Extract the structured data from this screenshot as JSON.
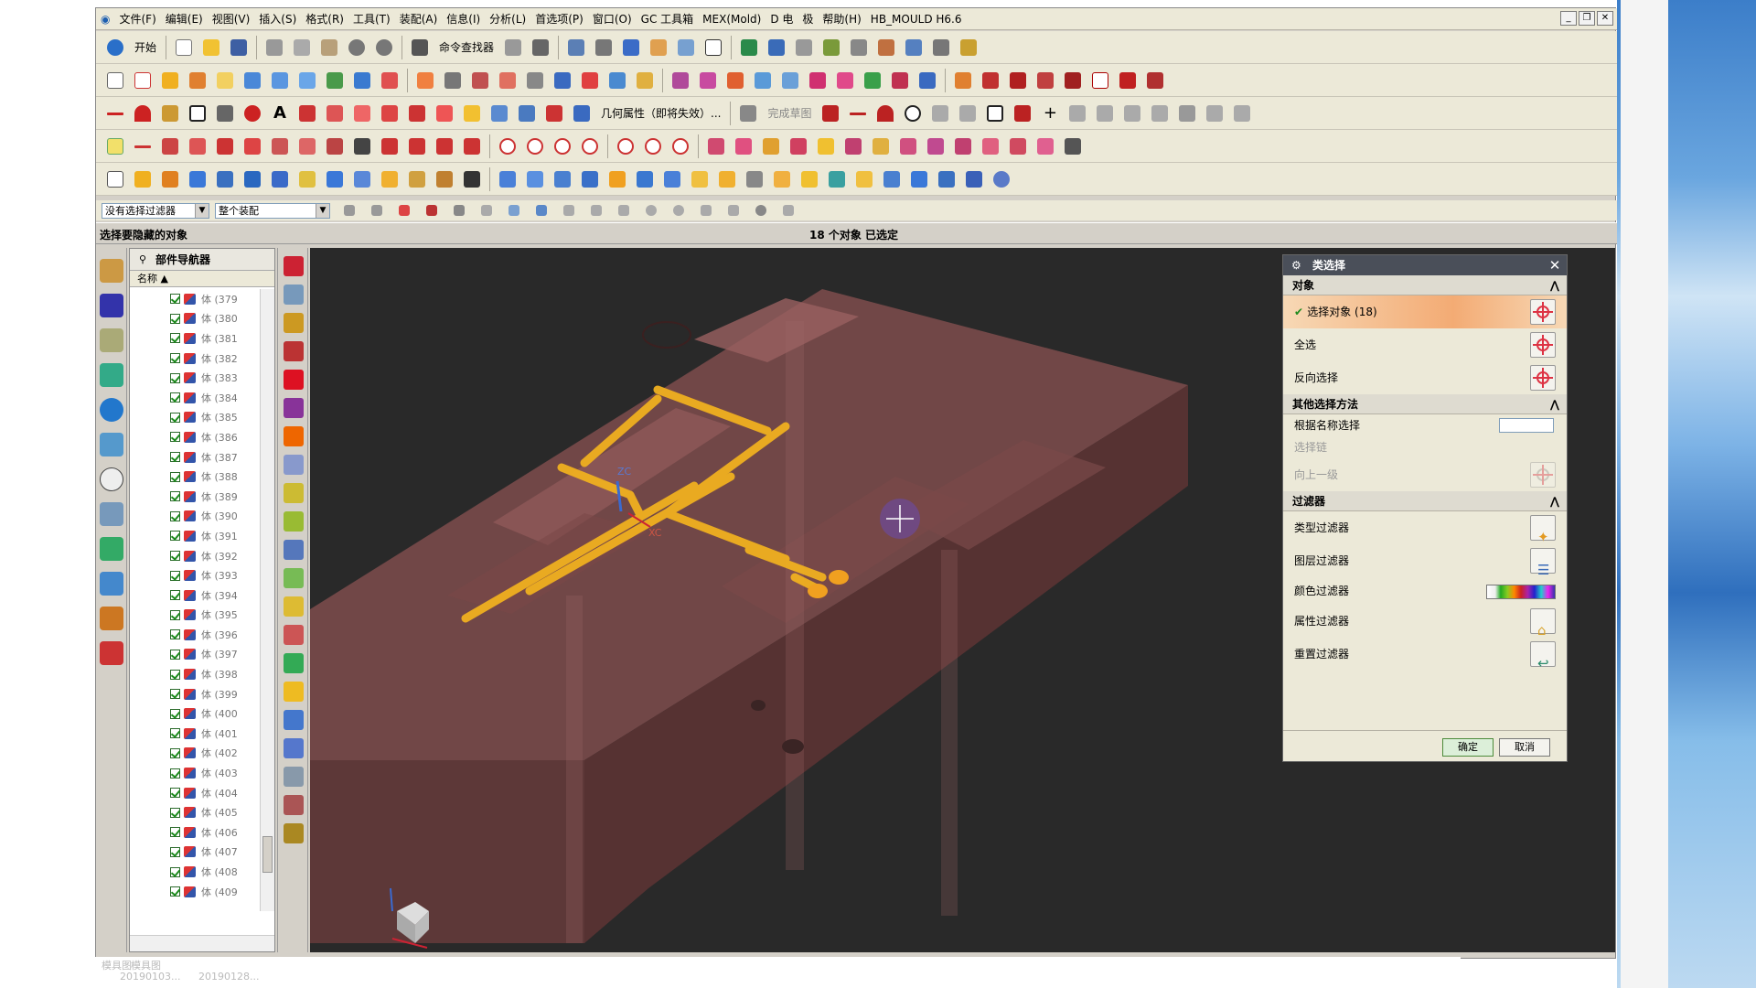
{
  "menu": [
    "文件(F)",
    "编辑(E)",
    "视图(V)",
    "插入(S)",
    "格式(R)",
    "工具(T)",
    "装配(A)",
    "信息(I)",
    "分析(L)",
    "首选项(P)",
    "窗口(O)",
    "GC 工具箱",
    "MEX(Mold)",
    "D 电",
    "极",
    "帮助(H)",
    "HB_MOULD H6.6"
  ],
  "toolbar": {
    "start": "开始",
    "command_finder": "命令查找器",
    "geom_props": "几何属性（即将失效）...",
    "sketch_done": "完成草图"
  },
  "selection": {
    "filter": "没有选择过滤器",
    "scope": "整个装配"
  },
  "status": {
    "cue": "选择要隐藏的对象",
    "count": "18 个对象 已选定"
  },
  "navigator": {
    "title": "部件导航器",
    "col": "名称",
    "rows": [
      "体 (379",
      "体 (380",
      "体 (381",
      "体 (382",
      "体 (383",
      "体 (384",
      "体 (385",
      "体 (386",
      "体 (387",
      "体 (388",
      "体 (389",
      "体 (390",
      "体 (391",
      "体 (392",
      "体 (393",
      "体 (394",
      "体 (395",
      "体 (396",
      "体 (397",
      "体 (398",
      "体 (399",
      "体 (400",
      "体 (401",
      "体 (402",
      "体 (403",
      "体 (404",
      "体 (405",
      "体 (406",
      "体 (407",
      "体 (408",
      "体 (409"
    ]
  },
  "dialog": {
    "title": "类选择",
    "sec_object": "对象",
    "select_object": "选择对象 (18)",
    "select_all": "全选",
    "invert": "反向选择",
    "sec_other": "其他选择方法",
    "by_name": "根据名称选择",
    "chain": "选择链",
    "up_one": "向上一级",
    "sec_filter": "过滤器",
    "type_filter": "类型过滤器",
    "layer_filter": "图层过滤器",
    "color_filter": "颜色过滤器",
    "attr_filter": "属性过滤器",
    "reset_filter": "重置过滤器",
    "ok": "确定",
    "cancel": "取消"
  },
  "viewport_labels": {
    "zc": "ZC",
    "xc": "XC"
  },
  "taskbar": [
    "模具图",
    "模具图",
    "20190103...",
    "20190128..."
  ],
  "colors": {
    "accent": "#f3ab74",
    "mold": "#b06a6a",
    "cooling": "#f0b020"
  }
}
